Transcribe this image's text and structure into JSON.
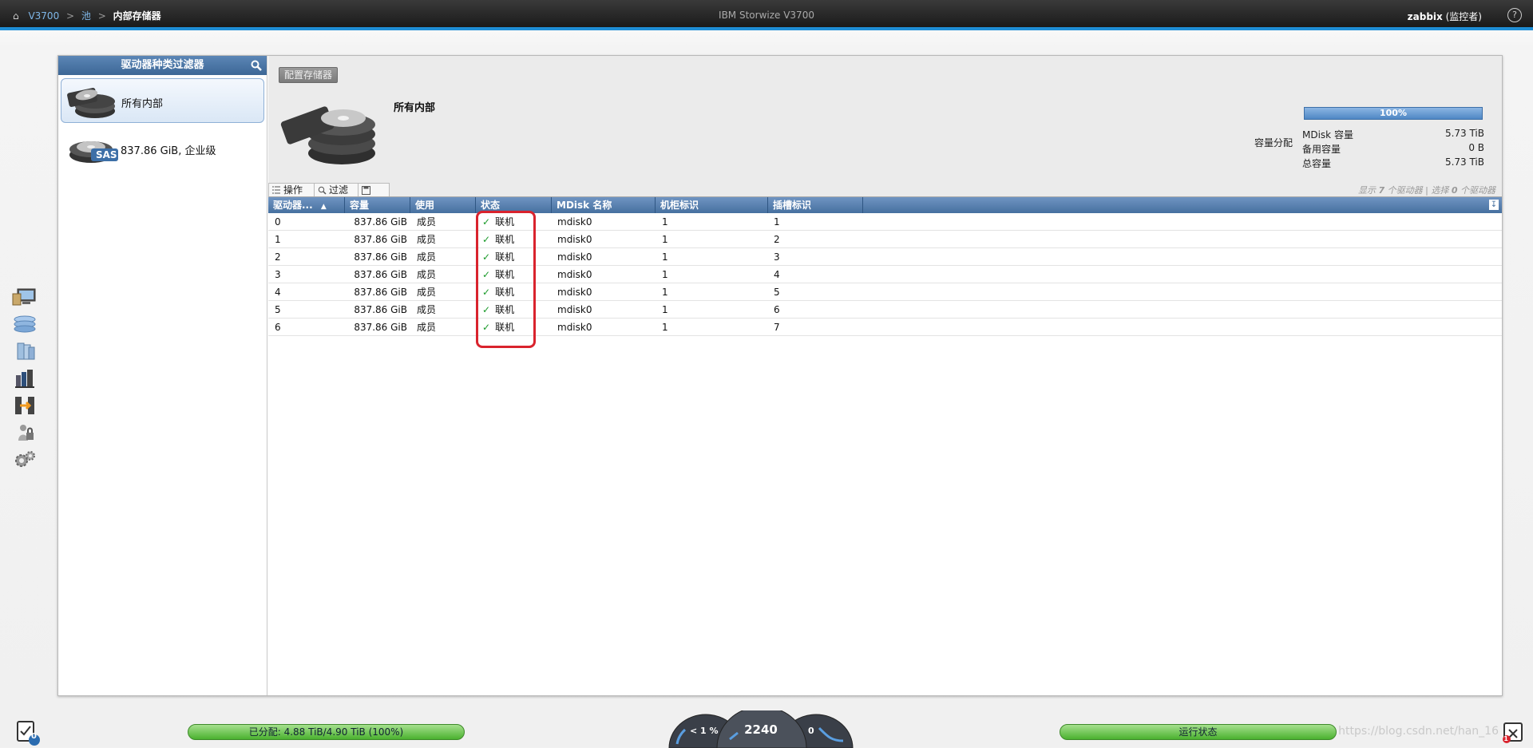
{
  "topbar": {
    "breadcrumb": {
      "home_icon": "home-icon",
      "system": "V3700",
      "pool": "池",
      "current": "内部存储器",
      "sep": ">"
    },
    "title": "IBM Storwize V3700",
    "user_name": "zabbix",
    "user_role": "(监控者)",
    "help": "?"
  },
  "rail": {
    "icons": [
      "monitoring-icon",
      "pools-icon",
      "volumes-icon",
      "hosts-icon",
      "copy-services-icon",
      "access-icon",
      "settings-icon"
    ]
  },
  "filter": {
    "header": "驱动器种类过滤器",
    "items": [
      {
        "label": "所有内部",
        "selected": true,
        "icon": "disk-stack-icon"
      },
      {
        "label": "837.86 GiB, 企业级",
        "selected": false,
        "icon": "sas-disk-icon",
        "badge": "SAS"
      }
    ]
  },
  "content": {
    "config_button": "配置存储器",
    "title": "所有内部",
    "capacity": {
      "title": "容量分配",
      "bar_text": "100%",
      "bar_percent": 100,
      "rows": [
        {
          "label": "MDisk 容量",
          "value": "5.73 TiB"
        },
        {
          "label": "备用容量",
          "value": "0 B"
        },
        {
          "label": "总容量",
          "value": "5.73 TiB"
        }
      ]
    },
    "tabs": {
      "actions": "操作",
      "filter": "过滤"
    },
    "summary": {
      "prefix": "显示",
      "shown": "7",
      "mid": "个驱动器 | 选择",
      "selected": "0",
      "suffix": "个驱动器"
    },
    "columns": [
      "驱动器...",
      "容量",
      "使用",
      "状态",
      "MDisk 名称",
      "机柜标识",
      "插槽标识"
    ],
    "rows": [
      {
        "id": "0",
        "capacity": "837.86 GiB",
        "use": "成员",
        "status": "联机",
        "mdisk": "mdisk0",
        "enclosure": "1",
        "slot": "1"
      },
      {
        "id": "1",
        "capacity": "837.86 GiB",
        "use": "成员",
        "status": "联机",
        "mdisk": "mdisk0",
        "enclosure": "1",
        "slot": "2"
      },
      {
        "id": "2",
        "capacity": "837.86 GiB",
        "use": "成员",
        "status": "联机",
        "mdisk": "mdisk0",
        "enclosure": "1",
        "slot": "3"
      },
      {
        "id": "3",
        "capacity": "837.86 GiB",
        "use": "成员",
        "status": "联机",
        "mdisk": "mdisk0",
        "enclosure": "1",
        "slot": "4"
      },
      {
        "id": "4",
        "capacity": "837.86 GiB",
        "use": "成员",
        "status": "联机",
        "mdisk": "mdisk0",
        "enclosure": "1",
        "slot": "5"
      },
      {
        "id": "5",
        "capacity": "837.86 GiB",
        "use": "成员",
        "status": "联机",
        "mdisk": "mdisk0",
        "enclosure": "1",
        "slot": "6"
      },
      {
        "id": "6",
        "capacity": "837.86 GiB",
        "use": "成员",
        "status": "联机",
        "mdisk": "mdisk0",
        "enclosure": "1",
        "slot": "7"
      }
    ]
  },
  "bottom": {
    "tasks_count": "0",
    "allocated": "已分配: 4.88 TiB/4.90 TiB (100%)",
    "gauge_left": "< 1 %",
    "gauge_center": "2240",
    "gauge_right": "0",
    "health": "运行状态",
    "watermark": "https://blog.csdn.net/han_16",
    "events_count": "1"
  },
  "colors": {
    "accent": "#1f8ed6",
    "header_blue": "#46709f",
    "ok_green": "#1a9a2a",
    "highlight_red": "#d9232d"
  }
}
